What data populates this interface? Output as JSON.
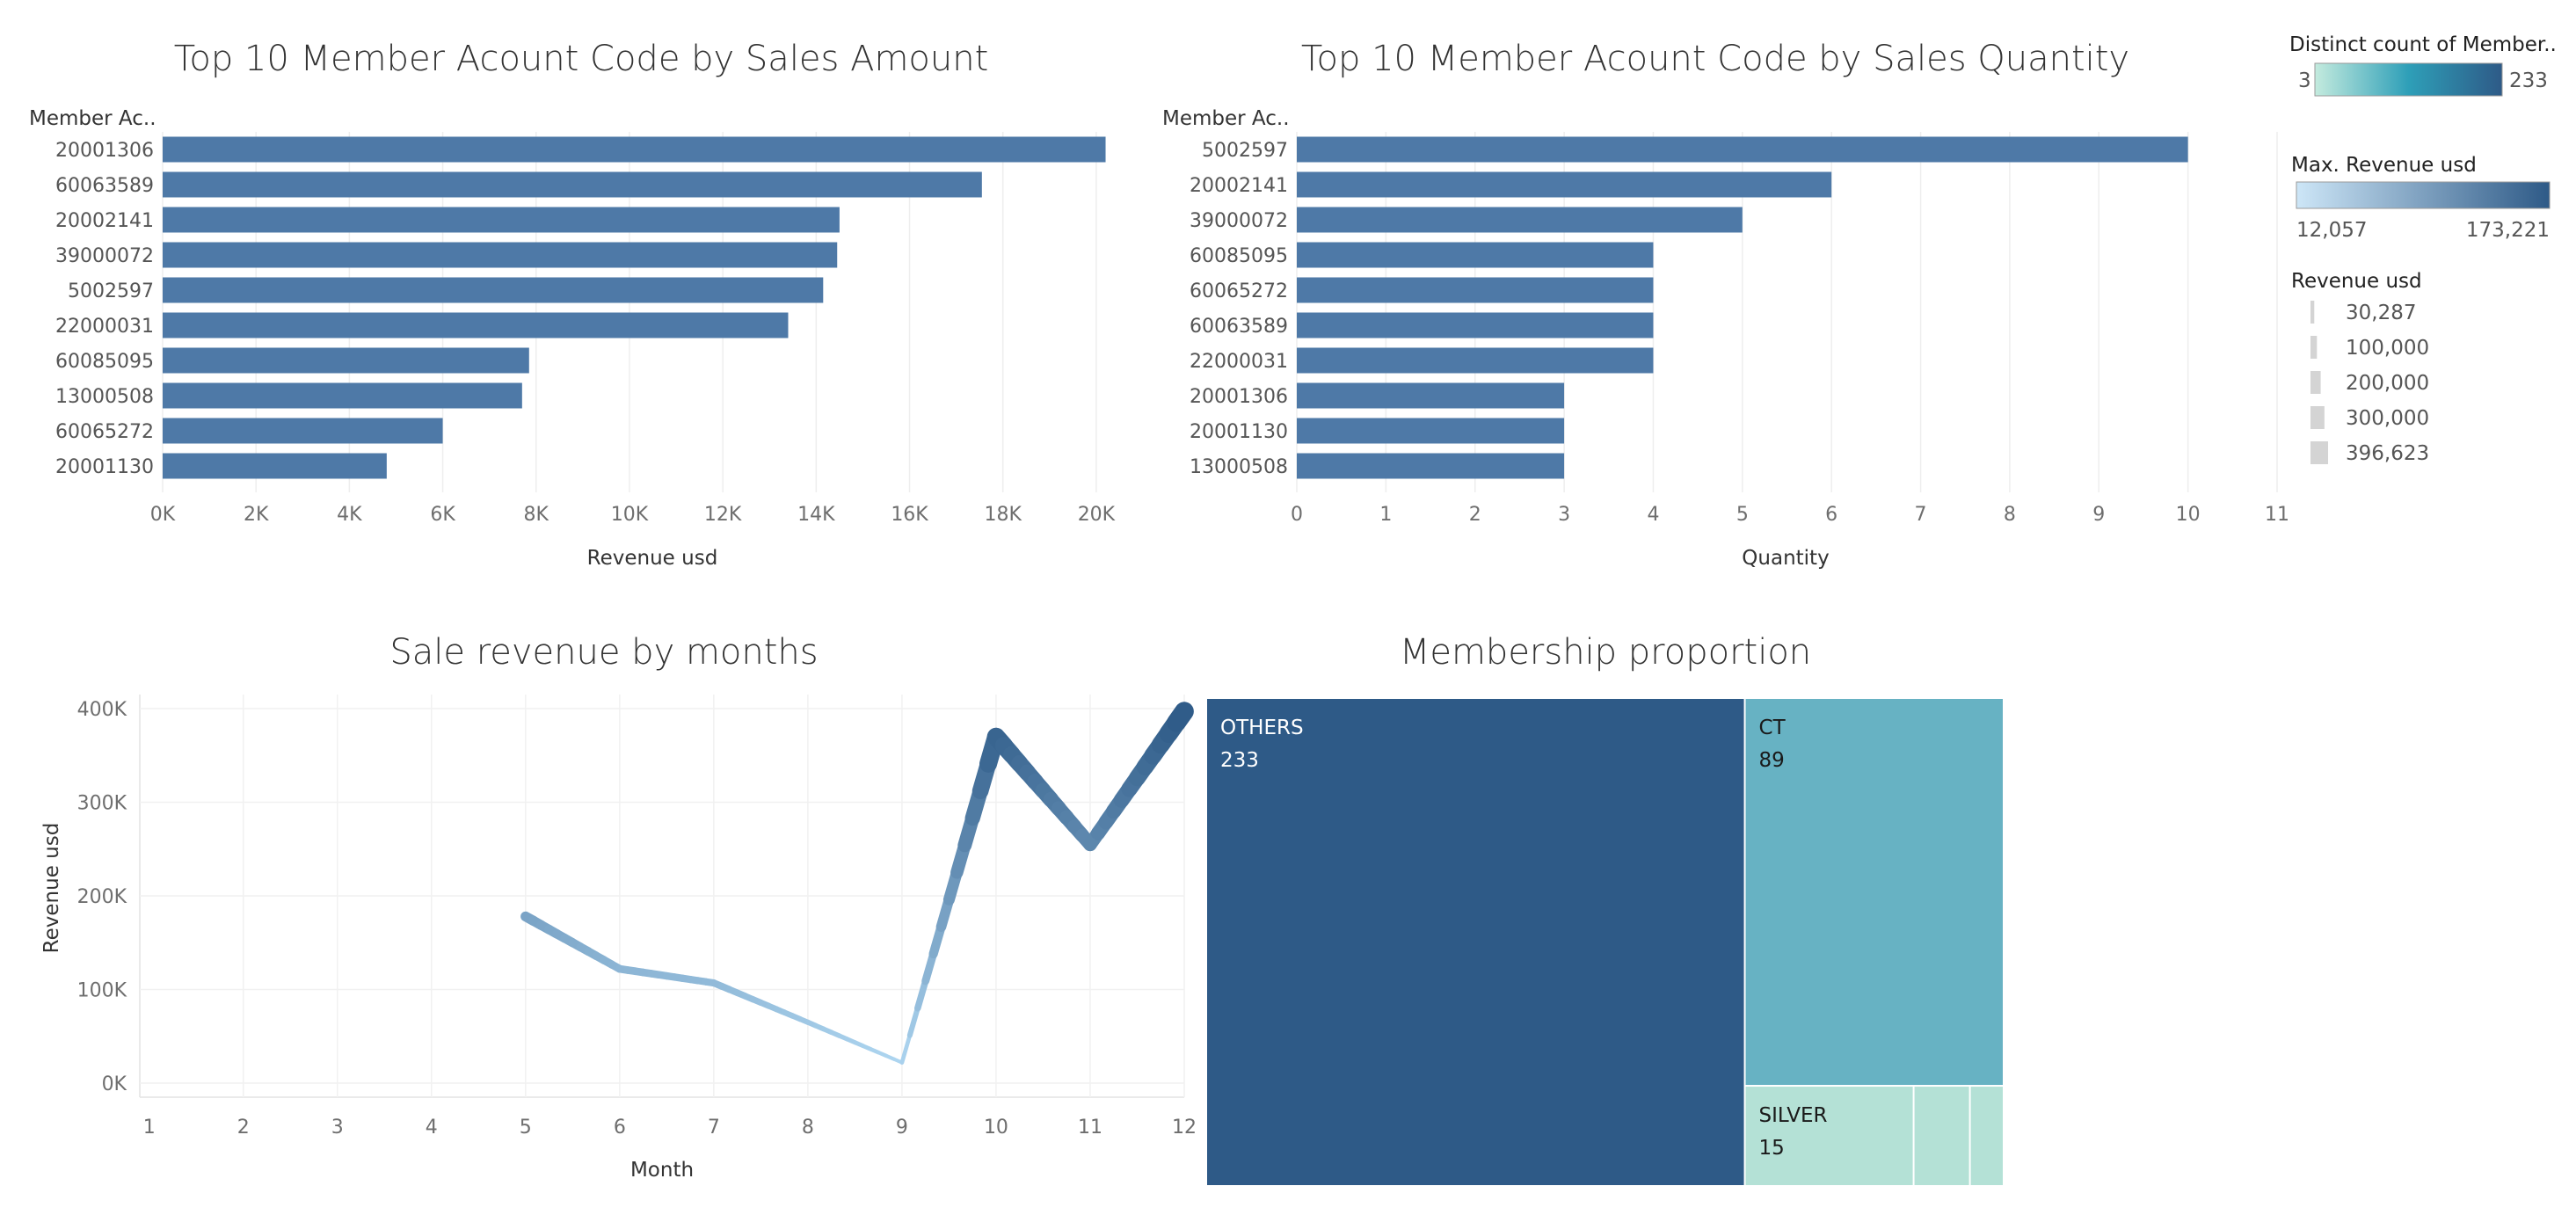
{
  "chart_data": [
    {
      "id": "amount",
      "type": "bar",
      "orientation": "horizontal",
      "title": "Top 10 Member Acount Code by Sales Amount",
      "ylabel": "Member Ac..",
      "xlabel": "Revenue usd",
      "categories": [
        "20001306",
        "60063589",
        "20002141",
        "39000072",
        "5002597",
        "22000031",
        "60085095",
        "13000508",
        "60065272",
        "20001130"
      ],
      "values": [
        20200,
        17550,
        14500,
        14450,
        14150,
        13400,
        7850,
        7700,
        6000,
        4800
      ],
      "xlim": [
        0,
        21000
      ],
      "xticks": [
        0,
        2000,
        4000,
        6000,
        8000,
        10000,
        12000,
        14000,
        16000,
        18000,
        20000
      ],
      "xtick_labels": [
        "0K",
        "2K",
        "4K",
        "6K",
        "8K",
        "10K",
        "12K",
        "14K",
        "16K",
        "18K",
        "20K"
      ],
      "bar_color": "#4e79a7",
      "grid": true
    },
    {
      "id": "quantity",
      "type": "bar",
      "orientation": "horizontal",
      "title": "Top 10 Member Acount Code by Sales Quantity",
      "ylabel": "Member Ac..",
      "xlabel": "Quantity",
      "categories": [
        "5002597",
        "20002141",
        "39000072",
        "60085095",
        "60065272",
        "60063589",
        "22000031",
        "20001306",
        "20001130",
        "13000508"
      ],
      "values": [
        10,
        6,
        5,
        4,
        4,
        4,
        4,
        3,
        3,
        3
      ],
      "xlim": [
        0,
        11
      ],
      "xticks": [
        0,
        1,
        2,
        3,
        4,
        5,
        6,
        7,
        8,
        9,
        10,
        11
      ],
      "xtick_labels": [
        "0",
        "1",
        "2",
        "3",
        "4",
        "5",
        "6",
        "7",
        "8",
        "9",
        "10",
        "11"
      ],
      "bar_color": "#4e79a7",
      "grid": true
    },
    {
      "id": "months",
      "type": "line",
      "title": "Sale revenue by months",
      "xlabel": "Month",
      "ylabel": "Revenue usd",
      "x": [
        5,
        6,
        7,
        8,
        9,
        10,
        11,
        12
      ],
      "y": [
        178000,
        122000,
        107000,
        65000,
        22000,
        370000,
        255000,
        397000
      ],
      "xlim": [
        0.9,
        12
      ],
      "ylim": [
        -15000,
        415000
      ],
      "xticks": [
        1,
        2,
        3,
        4,
        5,
        6,
        7,
        8,
        9,
        10,
        11,
        12
      ],
      "xtick_labels": [
        "1",
        "2",
        "3",
        "4",
        "5",
        "6",
        "7",
        "8",
        "9",
        "10",
        "11",
        "12"
      ],
      "yticks": [
        0,
        100000,
        200000,
        300000,
        400000
      ],
      "ytick_labels": [
        "0K",
        "100K",
        "200K",
        "300K",
        "400K"
      ],
      "color_range": [
        "#aed6f1",
        "#2e5a87"
      ],
      "grid": true
    },
    {
      "id": "membership",
      "type": "treemap",
      "title": "Membership proportion",
      "items": [
        {
          "label": "OTHERS",
          "value": 233,
          "color": "#2e5a87",
          "text_color": "#ffffff"
        },
        {
          "label": "CT",
          "value": 89,
          "color": "#67b2c3",
          "text_color": "#1a1a1a"
        },
        {
          "label": "SILVER",
          "value": 15,
          "color": "#b4e1d6",
          "text_color": "#1a1a1a"
        },
        {
          "label": "",
          "value": 5,
          "color": "#b4e1d6",
          "text_color": "#1a1a1a"
        },
        {
          "label": "",
          "value": 3,
          "color": "#b4e1d6",
          "text_color": "#1a1a1a"
        }
      ]
    }
  ],
  "legends": {
    "distinct_count": {
      "title": "Distinct count of Member..",
      "min": "3",
      "max": "233",
      "colors": [
        "#c4ebde",
        "#2e9fb8",
        "#2e5a87"
      ]
    },
    "max_revenue": {
      "title": "Max. Revenue usd",
      "min": "12,057",
      "max": "173,221",
      "colors": [
        "#cde6f7",
        "#2e5a87"
      ]
    },
    "revenue_size": {
      "title": "Revenue usd",
      "items": [
        {
          "label": "30,287",
          "value": 30287
        },
        {
          "label": "100,000",
          "value": 100000
        },
        {
          "label": "200,000",
          "value": 200000
        },
        {
          "label": "300,000",
          "value": 300000
        },
        {
          "label": "396,623",
          "value": 396623
        }
      ]
    }
  }
}
